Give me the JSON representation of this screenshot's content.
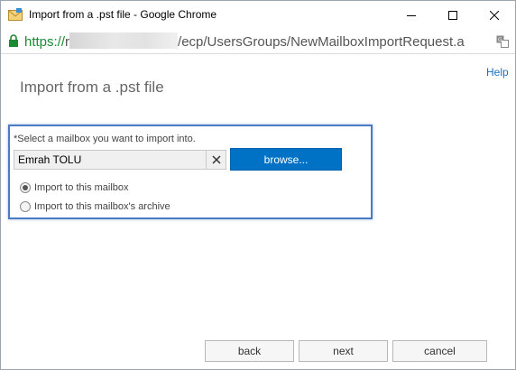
{
  "window": {
    "title": "Import from a .pst file - Google Chrome"
  },
  "address": {
    "scheme": "https://",
    "host_prefix": "r",
    "path": "/ecp/UsersGroups/NewMailboxImportRequest.a"
  },
  "page": {
    "help_label": "Help",
    "title": "Import from a .pst file",
    "select_label": "*Select a mailbox you want to import into.",
    "mailbox_value": "Emrah  TOLU",
    "browse_label": "browse...",
    "radio_options": [
      {
        "label": "Import to this mailbox",
        "checked": true
      },
      {
        "label": "Import to this mailbox's archive",
        "checked": false
      }
    ]
  },
  "footer": {
    "back_label": "back",
    "next_label": "next",
    "cancel_label": "cancel"
  },
  "colors": {
    "accent": "#0072c6",
    "highlight_border": "#4a7cc4",
    "secure_green": "#1a8a34"
  }
}
